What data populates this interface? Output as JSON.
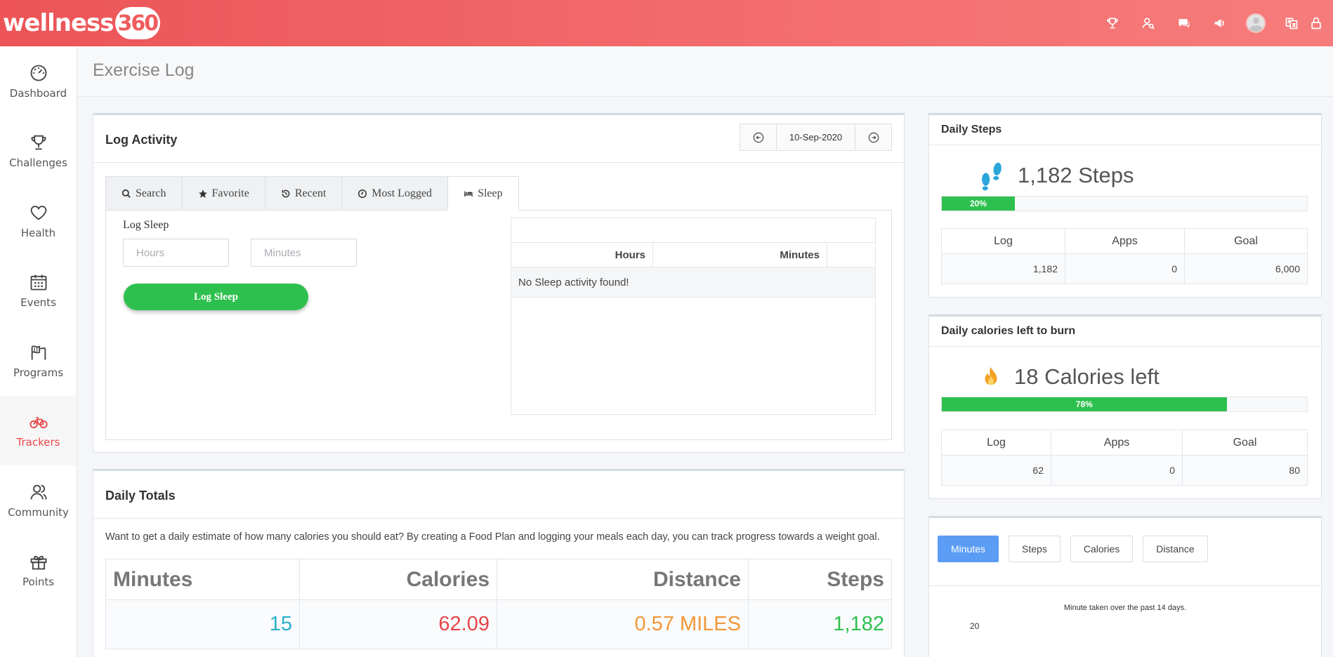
{
  "header": {
    "logo_text": "wellness",
    "logo_num": "360",
    "icons": [
      "trophy-icon",
      "user-search-icon",
      "chat-icon",
      "megaphone-icon",
      "avatar",
      "translate-icon",
      "lock-icon"
    ]
  },
  "sidebar": {
    "items": [
      {
        "label": "Dashboard",
        "icon": "gauge-icon"
      },
      {
        "label": "Challenges",
        "icon": "trophy-icon"
      },
      {
        "label": "Health",
        "icon": "heart-icon"
      },
      {
        "label": "Events",
        "icon": "calendar-icon"
      },
      {
        "label": "Programs",
        "icon": "flags-icon"
      },
      {
        "label": "Trackers",
        "icon": "bicycle-icon",
        "active": true
      },
      {
        "label": "Community",
        "icon": "people-icon"
      },
      {
        "label": "Points",
        "icon": "gift-icon"
      }
    ]
  },
  "page": {
    "title": "Exercise Log"
  },
  "log_activity": {
    "title": "Log Activity",
    "date": "10-Sep-2020",
    "tabs": [
      "Search",
      "Favorite",
      "Recent",
      "Most Logged",
      "Sleep"
    ],
    "active_tab": "Sleep",
    "sleep_label": "Log Sleep",
    "hours_placeholder": "Hours",
    "minutes_placeholder": "Minutes",
    "button_label": "Log Sleep",
    "table_headers": [
      "Hours",
      "Minutes"
    ],
    "empty_message": "No Sleep activity found!"
  },
  "daily_totals": {
    "title": "Daily Totals",
    "intro": "Want to get a daily estimate of how many calories you should eat? By creating a Food Plan and logging your meals each day, you can track progress towards a weight goal.",
    "columns": [
      {
        "label": "Minutes",
        "value": "15",
        "color": "#2aafc9"
      },
      {
        "label": "Calories",
        "value": "62.09",
        "color": "#e4464b"
      },
      {
        "label": "Distance",
        "value": "0.57 MILES",
        "color": "#f0973a"
      },
      {
        "label": "Steps",
        "value": "1,182",
        "color": "#2ec04e"
      }
    ]
  },
  "daily_steps": {
    "title": "Daily Steps",
    "stat": "1,182 Steps",
    "progress": 20,
    "progress_label": "20%",
    "headers": [
      "Log",
      "Apps",
      "Goal"
    ],
    "values": [
      "1,182",
      "0",
      "6,000"
    ]
  },
  "daily_calories": {
    "title": "Daily calories left to burn",
    "stat": "18 Calories left",
    "progress": 78,
    "progress_label": "78%",
    "headers": [
      "Log",
      "Apps",
      "Goal"
    ],
    "values": [
      "62",
      "0",
      "80"
    ]
  },
  "chart_panel": {
    "tabs": [
      "Minutes",
      "Steps",
      "Calories",
      "Distance"
    ],
    "active_tab": "Minutes",
    "chart_data": {
      "type": "bar",
      "title": "Minute taken over the past 14 days.",
      "y_ticks": [
        20
      ]
    }
  },
  "colors": {
    "accent": "#ef5b5d",
    "green": "#2ec04e",
    "blue": "#5b9cf4"
  }
}
